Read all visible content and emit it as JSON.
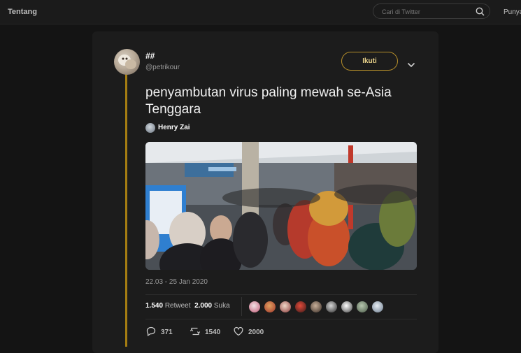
{
  "topbar": {
    "about": "Tentang",
    "right_link": "Punya",
    "search_placeholder": "Cari di Twitter",
    "search_icon": "search-icon"
  },
  "tweet": {
    "author_name": "##",
    "author_handle": "@petrikour",
    "follow_label": "Ikuti",
    "text": "penyambutan virus paling mewah se-Asia Tenggara",
    "mention_name": "Henry Zai",
    "timestamp": "22.03 - 25 Jan 2020",
    "retweets_count": "1.540",
    "retweets_label": "Retweet",
    "likes_count": "2.000",
    "likes_label": "Suka",
    "reply_count": "371",
    "retweet_action_count": "1540",
    "like_action_count": "2000"
  },
  "colors": {
    "accent": "#a57d12",
    "follow_text": "#e9d28a",
    "background": "#141414",
    "card": "#1c1c1c"
  }
}
